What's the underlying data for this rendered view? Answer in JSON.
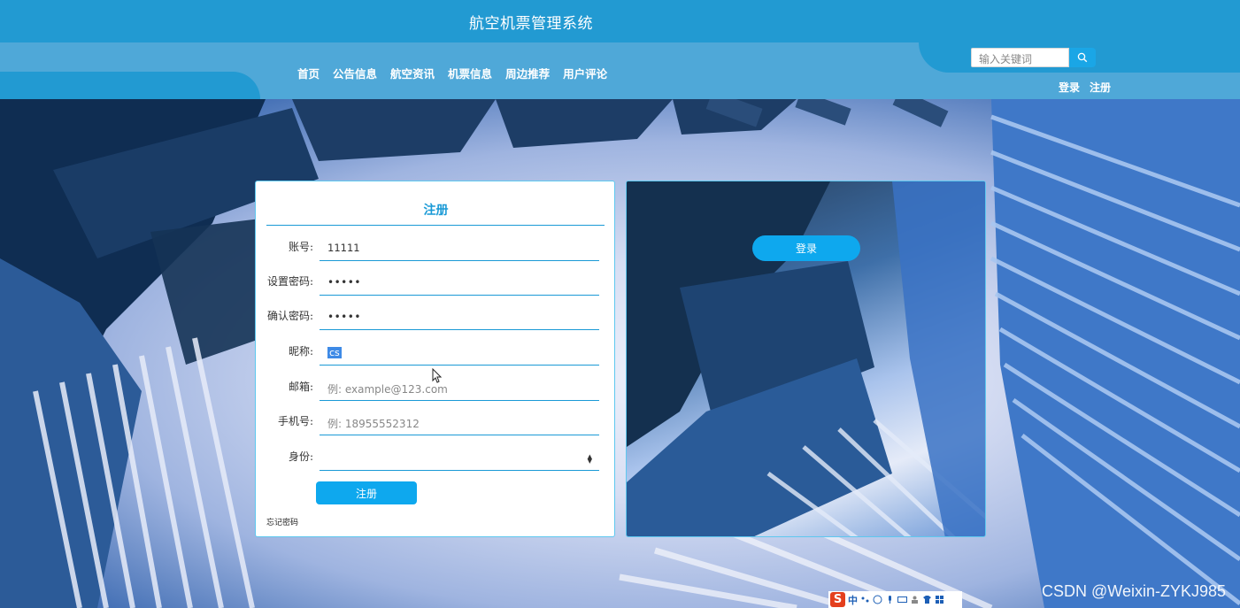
{
  "header": {
    "title": "航空机票管理系统",
    "nav": [
      "首页",
      "公告信息",
      "航空资讯",
      "机票信息",
      "周边推荐",
      "用户评论"
    ],
    "search": {
      "placeholder": "输入关键词",
      "icon": "search-icon"
    },
    "auth": {
      "login": "登录",
      "register": "注册"
    }
  },
  "register_form": {
    "title": "注册",
    "fields": [
      {
        "label": "账号:",
        "value": "11111",
        "placeholder": ""
      },
      {
        "label": "设置密码:",
        "value": "•••••",
        "placeholder": ""
      },
      {
        "label": "确认密码:",
        "value": "•••••",
        "placeholder": ""
      },
      {
        "label": "昵称:",
        "value": "cs",
        "placeholder": ""
      },
      {
        "label": "邮箱:",
        "value": "",
        "placeholder": "例: example@123.com"
      },
      {
        "label": "手机号:",
        "value": "",
        "placeholder": "例: 18955552312"
      },
      {
        "label": "身份:",
        "value": "",
        "placeholder": ""
      }
    ],
    "submit": "注册",
    "forgot": "忘记密码"
  },
  "side_panel": {
    "login": "登录"
  },
  "ime": {
    "logo": "S",
    "mode": "中"
  },
  "watermark": "CSDN @Weixin-ZYKJ985",
  "colors": {
    "header": "#229ad2",
    "nav_band": "#4fa8d8",
    "accent": "#0ea8ee",
    "title": "#1a9ad6"
  }
}
